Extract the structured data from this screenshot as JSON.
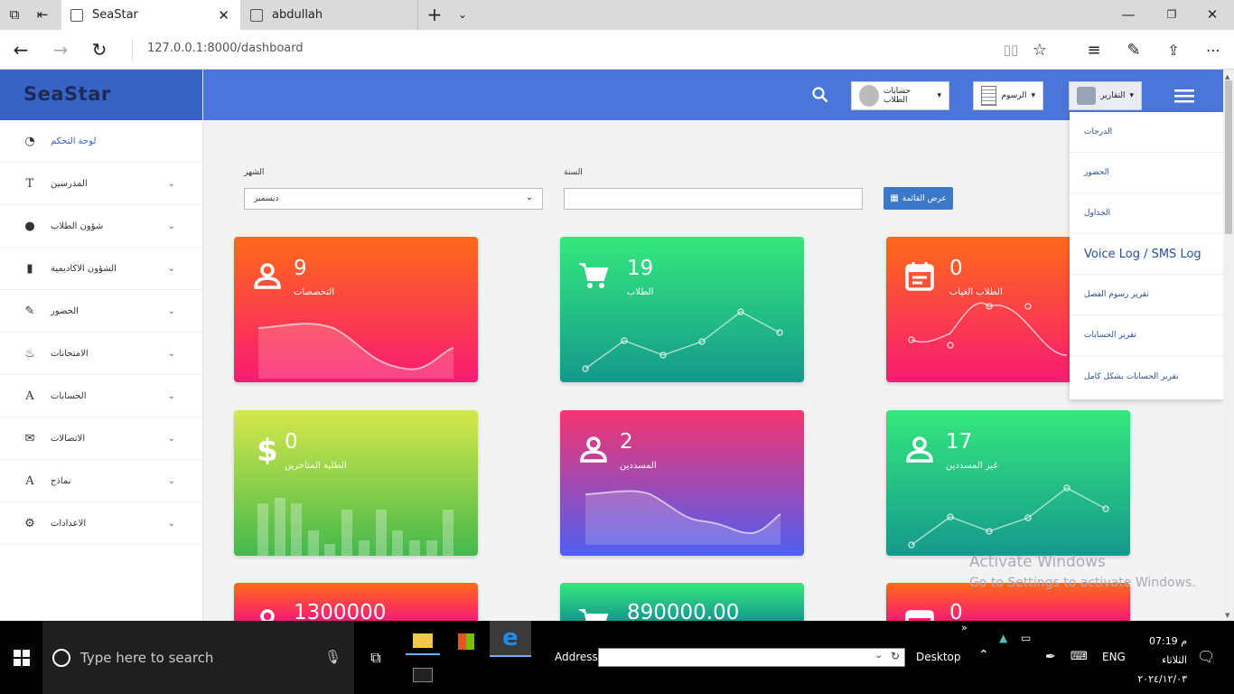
{
  "browser": {
    "tabs": [
      {
        "label": "SeaStar",
        "active": true
      },
      {
        "label": "abdullah",
        "active": false
      }
    ],
    "url": "127.0.0.1:8000/dashboard"
  },
  "app": {
    "brand": "SeaStar",
    "sidebar": [
      {
        "label": "لوحة التحكم",
        "icon": "dashboard-icon",
        "chevron": false
      },
      {
        "label": "المدرسين",
        "icon": "text-t-icon",
        "chevron": true
      },
      {
        "label": "شؤون الطلاب",
        "icon": "user-icon",
        "chevron": true
      },
      {
        "label": "الشؤون الاكاديمية",
        "icon": "book-icon",
        "chevron": true
      },
      {
        "label": "الحضور",
        "icon": "pencil-icon",
        "chevron": true
      },
      {
        "label": "الامتحانات",
        "icon": "fire-icon",
        "chevron": true
      },
      {
        "label": "الحسابات",
        "icon": "letter-a-icon",
        "chevron": true
      },
      {
        "label": "الاتصالات",
        "icon": "envelope-icon",
        "chevron": true
      },
      {
        "label": "نماذج",
        "icon": "letter-a-icon",
        "chevron": true
      },
      {
        "label": "الاعدادات",
        "icon": "gear-icon",
        "chevron": true
      }
    ],
    "topnav": {
      "student_accounts": "حسابات الطلاب",
      "fees": "الرسوم",
      "reports": "التقارير"
    },
    "filters": {
      "month_label": "الشهر",
      "month_value": "ديسمبر",
      "year_label": "السنة",
      "year_value": "",
      "show_button": "عرض القائمة"
    },
    "cards": [
      {
        "value": "9",
        "label": "التخصصات",
        "icon": "user-icon",
        "theme": "orange",
        "chart": "area"
      },
      {
        "value": "19",
        "label": "الطلاب",
        "icon": "cart-icon",
        "theme": "green",
        "chart": "line"
      },
      {
        "value": "0",
        "label": "الطلاب الغياب",
        "icon": "calendar-icon",
        "theme": "orange",
        "chart": "curve"
      },
      {
        "value": "0",
        "label": "الطلبة المتاخرين",
        "icon": "dollar-icon",
        "theme": "lime",
        "chart": "bars"
      },
      {
        "value": "2",
        "label": "المسددين",
        "icon": "user-icon",
        "theme": "pink",
        "chart": "area"
      },
      {
        "value": "17",
        "label": "غير المسددين",
        "icon": "user-icon",
        "theme": "green",
        "chart": "line"
      },
      {
        "value": "1300000",
        "label": "",
        "icon": "user-icon",
        "theme": "orange",
        "chart": "none"
      },
      {
        "value": "890000.00",
        "label": "",
        "icon": "cart-icon",
        "theme": "green",
        "chart": "none"
      },
      {
        "value": "0",
        "label": "",
        "icon": "calendar-icon",
        "theme": "orange",
        "chart": "none"
      }
    ],
    "reports_menu": [
      "الدرجات",
      "الحضور",
      "الجداول",
      "Voice Log / SMS Log",
      "تقرير رسوم الفصل",
      "تقرير الحسابات",
      "تقرير الحسابات بشكل كامل"
    ]
  },
  "watermark": {
    "line1": "Activate Windows",
    "line2": "Go to Settings to activate Windows."
  },
  "taskbar": {
    "search_placeholder": "Type here to search",
    "address_label": "Address",
    "desktop_label": "Desktop",
    "lang": "ENG",
    "time": "07:19",
    "ampm": "م",
    "day": "الثلاثاء",
    "date": "٢٠٢٤/١٢/٠٣"
  }
}
